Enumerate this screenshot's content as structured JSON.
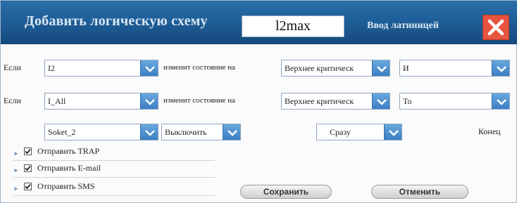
{
  "title": "Добавить логическую схему",
  "scheme_name": "l2max",
  "latin_label": "Ввод латиницей",
  "condition_rows": [
    {
      "prefix": "Если",
      "source": "I2",
      "changes_to_label": "изменит состояние на",
      "state": "Верхнее критическ",
      "operator": "И"
    },
    {
      "prefix": "Если",
      "source": "I_All",
      "changes_to_label": "изменит состояние на",
      "state": "Верхнее критическ",
      "operator": "То"
    }
  ],
  "output_row": {
    "socket": "Soket_2",
    "action": "Выключить",
    "timing": "Сразу",
    "end_label": "Конец"
  },
  "actions": [
    {
      "label": "Отправить TRAP",
      "checked": true
    },
    {
      "label": "Отправить E-mail",
      "checked": true
    },
    {
      "label": "Отправить SMS",
      "checked": true
    }
  ],
  "buttons": {
    "save": "Сохранить",
    "cancel": "Отменить"
  },
  "colors": {
    "titlebar": "#1f5f99",
    "close": "#e8533f",
    "dropdown_arrow": "#3b7fc4"
  }
}
